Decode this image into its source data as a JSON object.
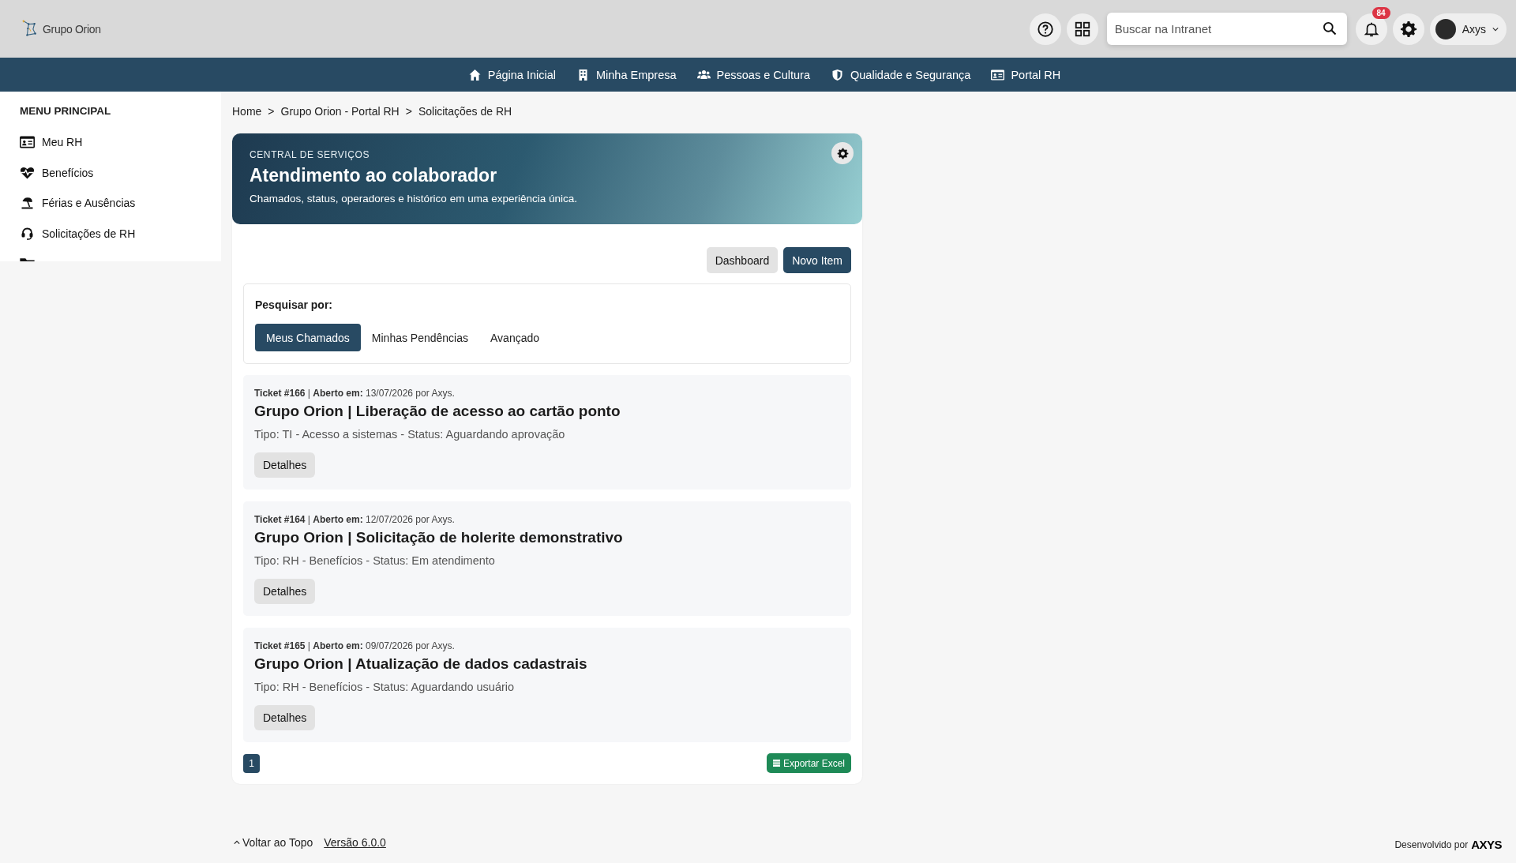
{
  "header": {
    "logo_text": "Grupo Orion",
    "search": {
      "placeholder": "Buscar na Intranet"
    },
    "notifications": {
      "count": "84"
    },
    "user": {
      "name": "Axys"
    }
  },
  "nav": {
    "items": [
      {
        "label": "Página Inicial"
      },
      {
        "label": "Minha Empresa"
      },
      {
        "label": "Pessoas e Cultura"
      },
      {
        "label": "Qualidade e Segurança"
      },
      {
        "label": "Portal RH"
      }
    ]
  },
  "sidebar": {
    "title": "MENU PRINCIPAL",
    "items": [
      {
        "label": "Meu RH"
      },
      {
        "label": "Benefícios"
      },
      {
        "label": "Férias e Ausências"
      },
      {
        "label": "Solicitações de RH"
      }
    ]
  },
  "breadcrumb": [
    "Home",
    "Grupo Orion - Portal RH",
    "Solicitações de RH"
  ],
  "breadcrumb_separator": ">",
  "banner": {
    "eyebrow": "CENTRAL DE SERVIÇOS",
    "title": "Atendimento ao colaborador",
    "subtitle": "Chamados, status, operadores e histórico em uma experiência única."
  },
  "actions": [
    "Dashboard",
    "Novo Item"
  ],
  "search_panel": {
    "label": "Pesquisar por:",
    "tabs": [
      {
        "label": "Meus Chamados",
        "selected": true
      },
      {
        "label": "Minhas Pendências",
        "selected": false
      },
      {
        "label": "Avançado",
        "selected": false
      }
    ]
  },
  "tickets": [
    {
      "meta": "**Ticket #166** | **Aberto em:** 13/07/2026 por Axys.",
      "title": "Grupo Orion | Liberação de acesso ao cartão ponto",
      "info": "Tipo: TI - Acesso a sistemas - Status: Aguardando aprovação",
      "button": "Detalhes"
    },
    {
      "meta": "**Ticket #164** | **Aberto em:** 12/07/2026 por Axys.",
      "title": "Grupo Orion | Solicitação de holerite demonstrativo",
      "info": "Tipo: RH - Benefícios - Status: Em atendimento",
      "button": "Detalhes"
    },
    {
      "meta": "**Ticket #165** | **Aberto em:** 09/07/2026 por Axys.",
      "title": "Grupo Orion | Atualização de dados cadastrais",
      "info": "Tipo: RH - Benefícios - Status: Aguardando usuário",
      "button": "Detalhes"
    }
  ],
  "pagination": [
    {
      "label": "1",
      "selected": true
    }
  ],
  "export_button": "Exportar Excel",
  "footer": {
    "back_to_top": "Voltar ao Topo",
    "version": "Versão 6.0.0",
    "credit": "Desenvolvido por",
    "credit_logo": "AXYS"
  }
}
